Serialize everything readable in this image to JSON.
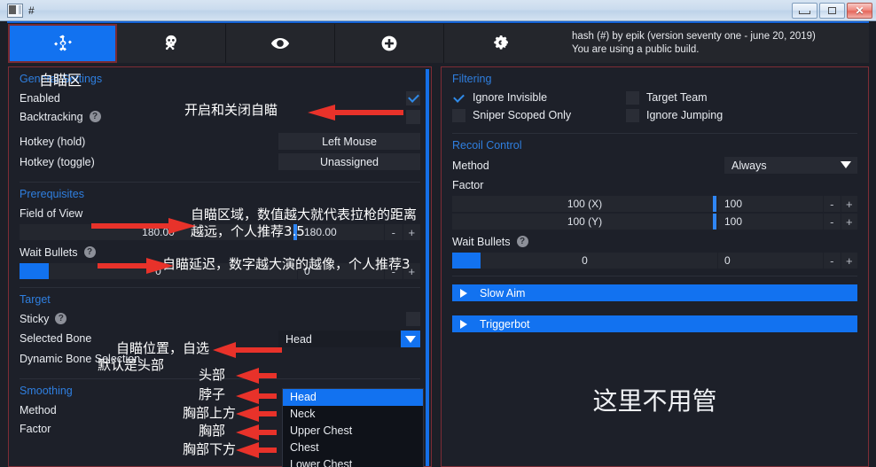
{
  "window": {
    "title": "#",
    "icon": "app-icon",
    "buttons": {
      "minimize": "–",
      "maximize": "□",
      "close": "✕"
    }
  },
  "tabs": [
    {
      "id": "aimbot",
      "icon": "crosshair-icon",
      "active": true
    },
    {
      "id": "rage",
      "icon": "skull-crossbones-icon",
      "active": false
    },
    {
      "id": "visuals",
      "icon": "eye-icon",
      "active": false
    },
    {
      "id": "misc",
      "icon": "plus-circle-icon",
      "active": false
    },
    {
      "id": "settings",
      "icon": "gears-icon",
      "active": false
    }
  ],
  "info": {
    "line1": "hash (#) by epik (version seventy one - june 20, 2019)",
    "line2": "You are using a public build."
  },
  "left": {
    "general": {
      "title": "General Settings",
      "enabled_label": "Enabled",
      "enabled_checked": true,
      "backtracking_label": "Backtracking",
      "backtracking_help": "?",
      "backtracking_checked": false,
      "hotkey_hold_label": "Hotkey (hold)",
      "hotkey_hold_value": "Left Mouse",
      "hotkey_toggle_label": "Hotkey (toggle)",
      "hotkey_toggle_value": "Unassigned"
    },
    "prerequisites": {
      "title": "Prerequisites",
      "fov_label": "Field of View",
      "fov_slider_value": "180.00",
      "fov_number_value": "180.00",
      "fov_minus": "-",
      "fov_plus": "+",
      "wait_bullets_label": "Wait Bullets",
      "wait_bullets_help": "?",
      "wait_slider_value": "0",
      "wait_number_value": "0",
      "wait_minus": "-",
      "wait_plus": "+"
    },
    "target": {
      "title": "Target",
      "sticky_label": "Sticky",
      "sticky_help": "?",
      "sticky_checked": false,
      "selected_bone_label": "Selected Bone",
      "selected_bone_value": "Head",
      "dynamic_bone_label": "Dynamic Bone Selection",
      "bone_options": [
        "Head",
        "Neck",
        "Upper Chest",
        "Chest",
        "Lower Chest"
      ],
      "bone_selected_index": 0
    },
    "smoothing": {
      "title": "Smoothing",
      "method_label": "Method",
      "factor_label": "Factor"
    }
  },
  "right": {
    "filtering": {
      "title": "Filtering",
      "items": [
        {
          "label": "Ignore Invisible",
          "checked": true
        },
        {
          "label": "Target Team",
          "checked": false
        },
        {
          "label": "Sniper Scoped Only",
          "checked": false
        },
        {
          "label": "Ignore Jumping",
          "checked": false
        }
      ]
    },
    "recoil": {
      "title": "Recoil Control",
      "method_label": "Method",
      "method_value": "Always",
      "factor_label": "Factor",
      "x_slider_value": "100 (X)",
      "x_number_value": "100",
      "y_slider_value": "100 (Y)",
      "y_number_value": "100",
      "minus": "-",
      "plus": "+",
      "wait_bullets_label": "Wait Bullets",
      "wait_bullets_help": "?",
      "wait_slider_value": "0",
      "wait_number_value": "0"
    },
    "collapsed": [
      {
        "label": "Slow Aim"
      },
      {
        "label": "Triggerbot"
      }
    ],
    "note": "这里不用管"
  },
  "annotations": {
    "tab_label": "自瞄区",
    "enabled": "开启和关闭自瞄",
    "fov_line1": "自瞄区域，数值越大就代表拉枪的距离",
    "fov_line2": "越远，个人推荐3.5",
    "wait_bullets": "自瞄延迟，数字越大演的越像，个人推荐3",
    "bone_line1": "自瞄位置，自选",
    "bone_line2": "默认是头部",
    "bone_head": "头部",
    "bone_neck": "脖子",
    "bone_upper_chest": "胸部上方",
    "bone_chest": "胸部",
    "bone_lower_chest": "胸部下方"
  },
  "colors": {
    "accent_blue": "#1272f0",
    "panel_border_red": "#7e2c35",
    "section_label": "#2f7fe0",
    "background": "#1d2029",
    "arrow_red": "#e8322a"
  }
}
